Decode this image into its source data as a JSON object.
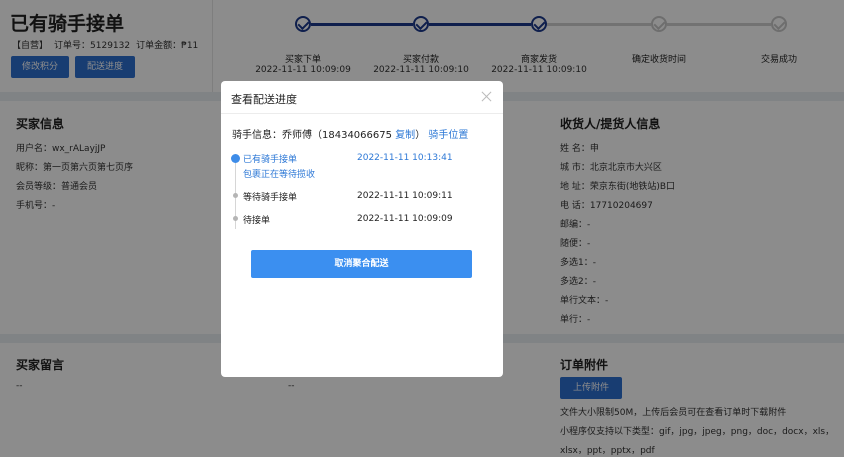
{
  "header": {
    "status_title": "已有骑手接单",
    "tag": "【自营】",
    "order_no": "订单号：5129132",
    "order_amount": "订单金额：₱11",
    "points_button": "修改积分",
    "delivery_button": "配送进度"
  },
  "steps": [
    {
      "label": "买家下单",
      "time": "2022-11-11 10:09:09",
      "done": true
    },
    {
      "label": "买家付款",
      "time": "2022-11-11 10:09:10",
      "done": true
    },
    {
      "label": "商家发货",
      "time": "2022-11-11 10:09:10",
      "done": true
    },
    {
      "label": "确定收货时间",
      "time": "",
      "done": false
    },
    {
      "label": "交易成功",
      "time": "",
      "done": false
    }
  ],
  "buyer": {
    "title": "买家信息",
    "username": "用户名：wx_rALayjJP",
    "nickname": "昵称：第一页第六页第七页序",
    "level": "会员等级：普通会员",
    "phone": "手机号：-"
  },
  "receiver": {
    "title": "收货人/提货人信息",
    "fields": [
      "姓 名：申",
      "城 市：北京北京市大兴区",
      "地 址：荣京东街(地铁站)B口",
      "电 话：17710204697",
      "邮编：-",
      "随便：-",
      "多选1：-",
      "多选2：-",
      "单行文本：-",
      "单行：-"
    ]
  },
  "message": {
    "title": "买家留言",
    "value": "--",
    "value2": "--"
  },
  "attachment": {
    "title": "订单附件",
    "upload_button": "上传附件",
    "note1": "文件大小限制50M，上传后会员可在查看订单时下载附件",
    "note2": "小程序仅支持以下类型：gif，jpg，jpeg，png，doc，docx，xls，",
    "note3": "xlsx，ppt，pptx，pdf"
  },
  "modal": {
    "title": "查看配送进度",
    "rider_prefix": "骑手信息：乔师傅（18434066675",
    "copy_link": "复制",
    "rider_suffix": "）",
    "location_link": "骑手位置",
    "timeline": [
      {
        "text": "已有骑手接单",
        "sub": "包裹正在等待揽收",
        "time": "2022-11-11 10:13:41",
        "active": true
      },
      {
        "text": "等待骑手接单",
        "sub": "",
        "time": "2022-11-11 10:09:11",
        "active": false
      },
      {
        "text": "待接单",
        "sub": "",
        "time": "2022-11-11 10:09:09",
        "active": false
      }
    ],
    "cancel_button": "取消聚合配送"
  },
  "colors": {
    "primary": "#2d6fcf",
    "step_done": "#1c3a8c",
    "link": "#2d78d6",
    "cancel": "#3b8ff0"
  }
}
